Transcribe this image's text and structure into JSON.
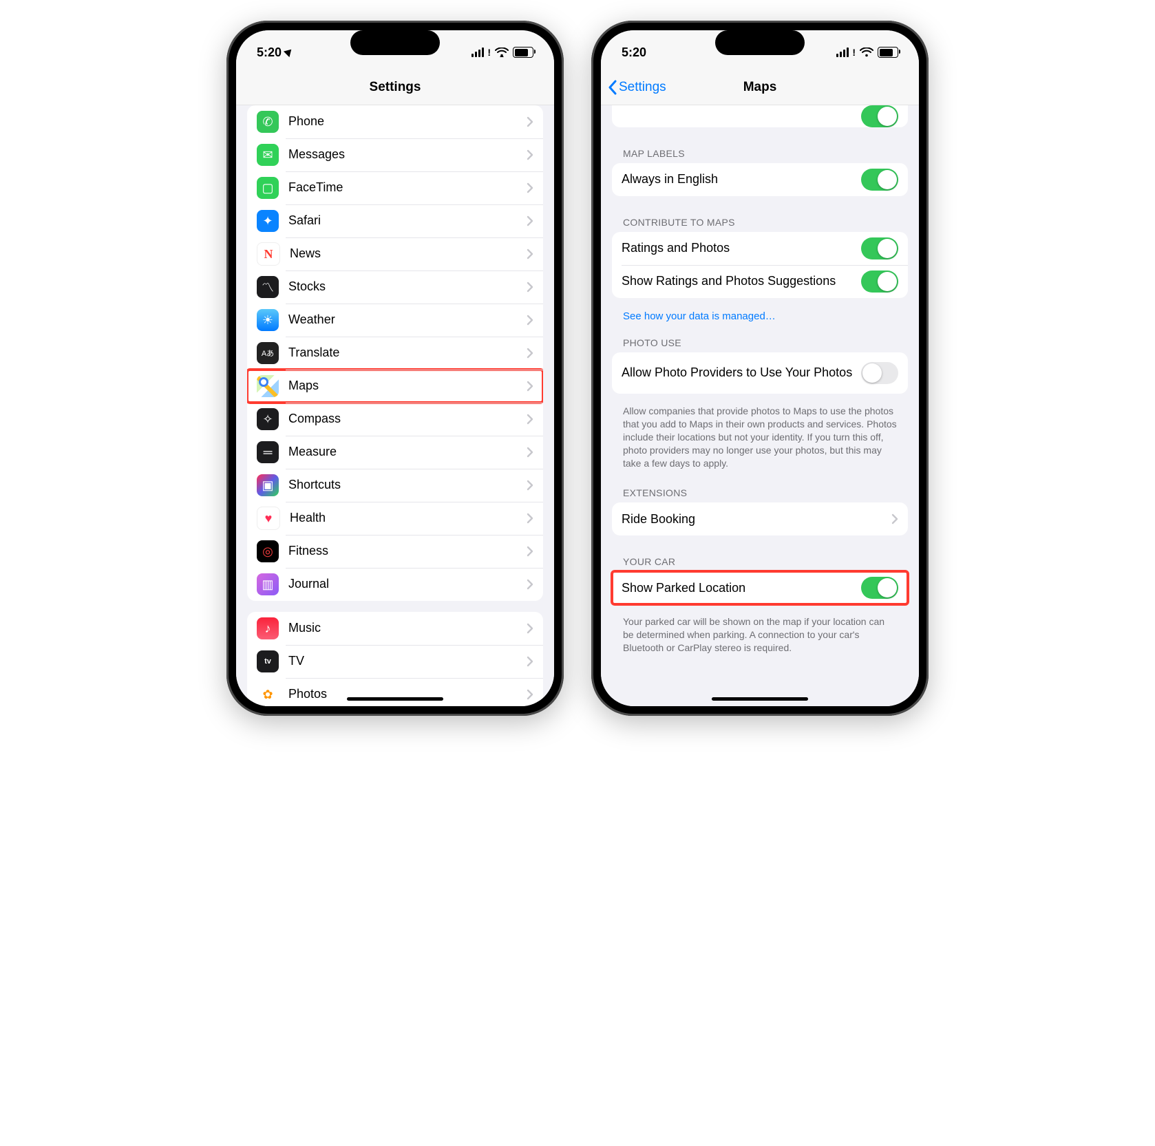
{
  "status": {
    "time": "5:20"
  },
  "phone_left": {
    "title": "Settings",
    "highlighted": "Maps",
    "items": [
      {
        "label": "Phone",
        "icon": "phone-icon",
        "bg": "bg-green",
        "glyph": "✆"
      },
      {
        "label": "Messages",
        "icon": "messages-icon",
        "bg": "bg-green2",
        "glyph": "✉"
      },
      {
        "label": "FaceTime",
        "icon": "facetime-icon",
        "bg": "bg-green2",
        "glyph": "▢"
      },
      {
        "label": "Safari",
        "icon": "safari-icon",
        "bg": "bg-blue",
        "glyph": "✦"
      },
      {
        "label": "News",
        "icon": "news-icon",
        "bg": "bg-white",
        "glyph": "N"
      },
      {
        "label": "Stocks",
        "icon": "stocks-icon",
        "bg": "bg-black",
        "glyph": "〽"
      },
      {
        "label": "Weather",
        "icon": "weather-icon",
        "bg": "bg-skyblue",
        "glyph": "☀"
      },
      {
        "label": "Translate",
        "icon": "translate-icon",
        "bg": "bg-dark",
        "glyph": "Aあ"
      },
      {
        "label": "Maps",
        "icon": "maps-icon",
        "bg": "maps-icon",
        "glyph": ""
      },
      {
        "label": "Compass",
        "icon": "compass-icon",
        "bg": "bg-black",
        "glyph": "✧"
      },
      {
        "label": "Measure",
        "icon": "measure-icon",
        "bg": "bg-measure",
        "glyph": "═"
      },
      {
        "label": "Shortcuts",
        "icon": "shortcuts-icon",
        "bg": "bg-shortcuts",
        "glyph": "▣"
      },
      {
        "label": "Health",
        "icon": "health-icon",
        "bg": "bg-white",
        "glyph": "♥"
      },
      {
        "label": "Fitness",
        "icon": "fitness-icon",
        "bg": "bg-fitness",
        "glyph": "◎"
      },
      {
        "label": "Journal",
        "icon": "journal-icon",
        "bg": "bg-journal",
        "glyph": "▥"
      }
    ],
    "items2": [
      {
        "label": "Music",
        "icon": "music-icon",
        "bg": "bg-music",
        "glyph": "♪"
      },
      {
        "label": "TV",
        "icon": "tv-icon",
        "bg": "bg-black",
        "glyph": "tv"
      },
      {
        "label": "Photos",
        "icon": "photos-icon",
        "bg": "bg-photos",
        "glyph": "✿"
      }
    ]
  },
  "phone_right": {
    "back": "Settings",
    "title": "Maps",
    "sections": {
      "map_labels": {
        "header": "MAP LABELS",
        "rows": [
          {
            "label": "Always in English",
            "toggle": true
          }
        ]
      },
      "contribute": {
        "header": "CONTRIBUTE TO MAPS",
        "rows": [
          {
            "label": "Ratings and Photos",
            "toggle": true
          },
          {
            "label": "Show Ratings and Photos Suggestions",
            "toggle": true
          }
        ],
        "link": "See how your data is managed…"
      },
      "photo_use": {
        "header": "PHOTO USE",
        "rows": [
          {
            "label": "Allow Photo Providers to Use Your Photos",
            "toggle": false
          }
        ],
        "footer": "Allow companies that provide photos to Maps to use the photos that you add to Maps in their own products and services. Photos include their locations but not your identity. If you turn this off, photo providers may no longer use your photos, but this may take a few days to apply."
      },
      "extensions": {
        "header": "EXTENSIONS",
        "rows": [
          {
            "label": "Ride Booking",
            "type": "disclosure"
          }
        ]
      },
      "your_car": {
        "header": "YOUR CAR",
        "rows": [
          {
            "label": "Show Parked Location",
            "toggle": true,
            "highlight": true
          }
        ],
        "footer": "Your parked car will be shown on the map if your location can be determined when parking. A connection to your car's Bluetooth or CarPlay stereo is required."
      }
    }
  }
}
